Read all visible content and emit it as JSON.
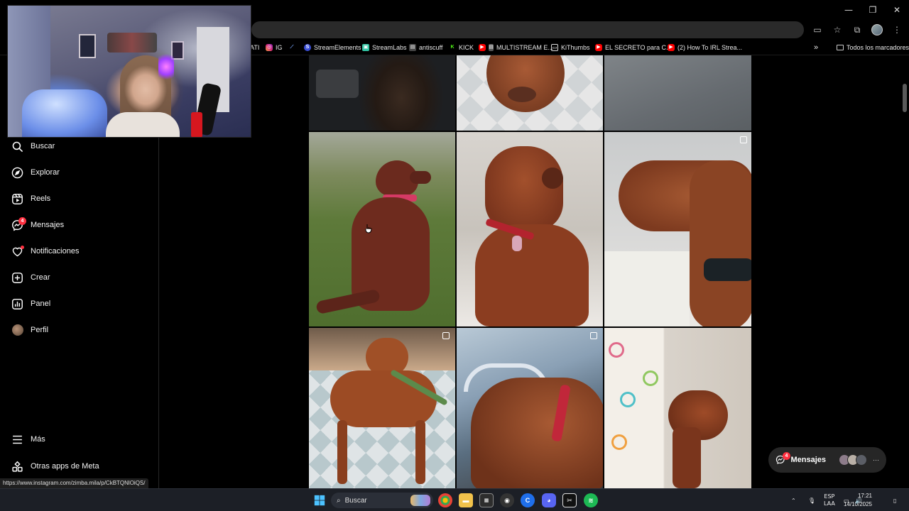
{
  "window": {
    "minimize": "—",
    "maximize": "❐",
    "close": "✕"
  },
  "bookmarks": {
    "items": [
      {
        "label": "ATI",
        "icon": "ati-icon"
      },
      {
        "label": "IG",
        "icon": "instagram-icon"
      },
      {
        "label": "",
        "icon": "chart-icon"
      },
      {
        "label": "StreamElements",
        "icon": "streamelements-icon"
      },
      {
        "label": "StreamLabs",
        "icon": "streamlabs-icon"
      },
      {
        "label": "antiscuff",
        "icon": "page-icon"
      },
      {
        "label": "KICK",
        "icon": "kick-icon"
      },
      {
        "label": "MULTISTREAM E...",
        "icon": "youtube-icon"
      },
      {
        "label": "KiThumbs",
        "icon": "kithumbs-icon"
      },
      {
        "label": "EL SECRETO para C...",
        "icon": "youtube-icon"
      },
      {
        "label": "(2) How To IRL Strea...",
        "icon": "youtube-icon"
      }
    ],
    "overflow": "»",
    "all_bookmarks": "Todos los marcadores"
  },
  "sidebar": {
    "items": [
      {
        "label": "Buscar",
        "icon": "search-icon"
      },
      {
        "label": "Explorar",
        "icon": "compass-icon"
      },
      {
        "label": "Reels",
        "icon": "reels-icon"
      },
      {
        "label": "Mensajes",
        "icon": "messenger-icon",
        "badge": "4"
      },
      {
        "label": "Notificaciones",
        "icon": "heart-icon"
      },
      {
        "label": "Crear",
        "icon": "plus-square-icon"
      },
      {
        "label": "Panel",
        "icon": "bar-chart-icon"
      },
      {
        "label": "Perfil",
        "icon": "profile-avatar"
      }
    ],
    "more": "Más",
    "meta_apps": "Otras apps de Meta"
  },
  "status_url": "https://www.instagram.com/zimba.mila/p/CkBTQNlOiQS/",
  "messages_pill": {
    "label": "Mensajes",
    "badge": "4",
    "more": "···"
  },
  "taskbar": {
    "search_label": "Buscar",
    "lang_line1": "ESP",
    "lang_line2": "LAA",
    "time": "17:21",
    "date": "14/10/2025"
  },
  "colors": {
    "accent_badge": "#ff3040",
    "sidebar_bg": "#000000",
    "taskbar_bg": "#1c1f26"
  }
}
